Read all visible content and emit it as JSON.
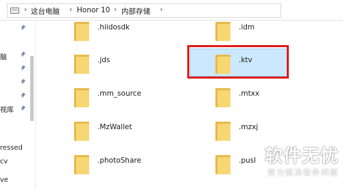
{
  "breadcrumb": {
    "items": [
      "这台电脑",
      "Honor 10",
      "内部存储"
    ],
    "separator": "›",
    "lead_separator": "›"
  },
  "nav": {
    "items": [
      {
        "label": "",
        "pinned": true
      },
      {
        "label": "脑",
        "pinned": true
      },
      {
        "label": "",
        "pinned": true
      },
      {
        "label": "",
        "pinned": true
      },
      {
        "label": "",
        "pinned": true
      },
      {
        "label": "视库",
        "pinned": true
      },
      {
        "label": "",
        "pinned": false
      },
      {
        "label": "ressed",
        "pinned": false
      },
      {
        "label": "cv",
        "pinned": false
      },
      {
        "label": "ve",
        "pinned": false
      }
    ]
  },
  "files": {
    "left": [
      ".hiidosdk",
      ".jds",
      ".mm_source",
      ".MzWallet",
      ".photoShare"
    ],
    "right": [
      ".idm",
      ".ktv",
      ".mtxx",
      ".mzxj",
      ".pusl"
    ],
    "selected": ".ktv"
  },
  "watermark": {
    "logo": "软件无忧",
    "sub": "努力解决软件问题"
  },
  "colors": {
    "selection_bg": "#cce8ff",
    "highlight_border": "#e01818",
    "folder_front": "#f7d774"
  }
}
